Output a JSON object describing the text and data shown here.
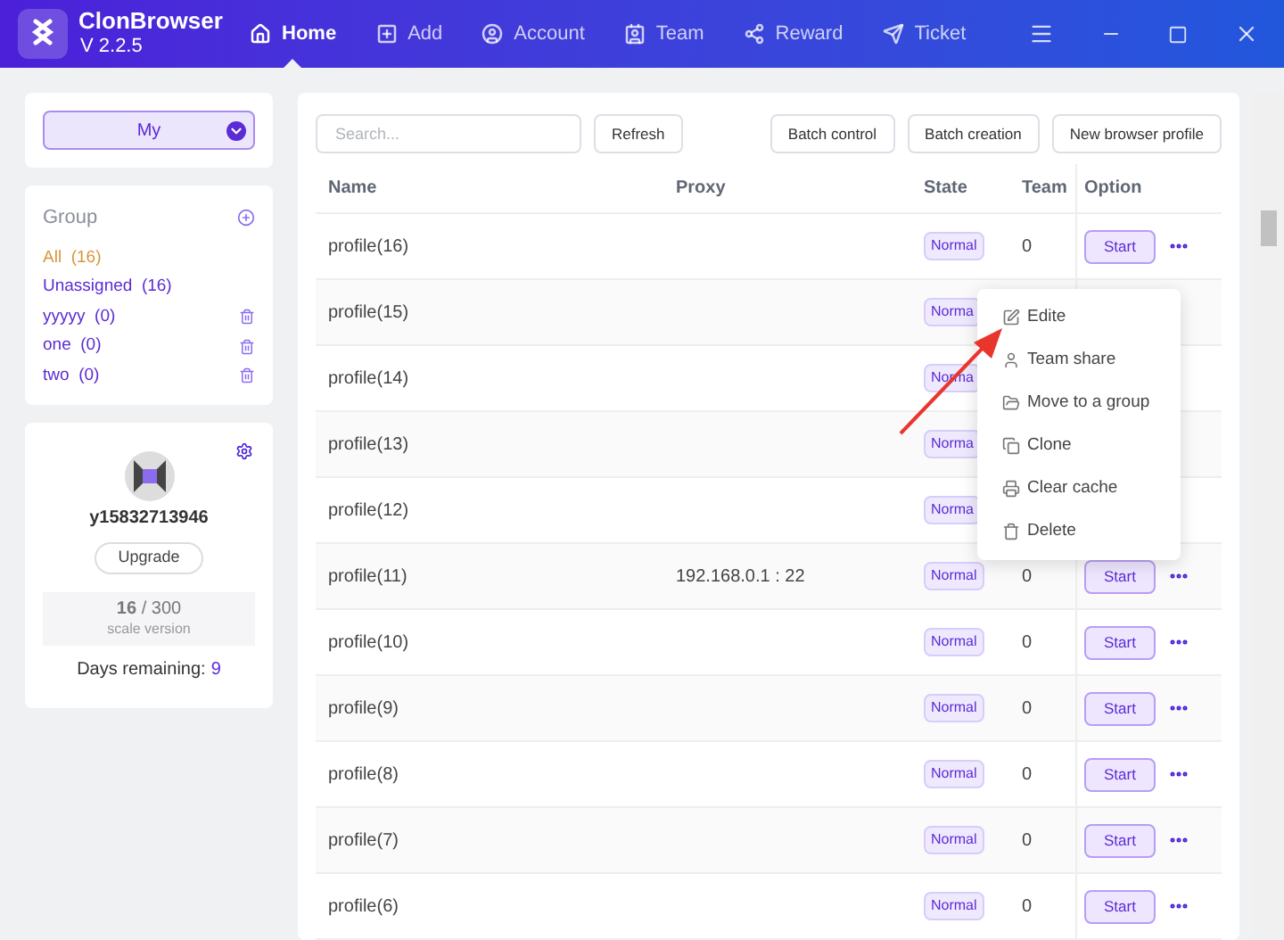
{
  "app": {
    "name": "ClonBrowser",
    "version": "V 2.2.5"
  },
  "nav": [
    {
      "label": "Home",
      "selected": true
    },
    {
      "label": "Add",
      "selected": false
    },
    {
      "label": "Account",
      "selected": false
    },
    {
      "label": "Team",
      "selected": false
    },
    {
      "label": "Reward",
      "selected": false
    },
    {
      "label": "Ticket",
      "selected": false
    }
  ],
  "group_selector": {
    "label": "My"
  },
  "groups": {
    "title": "Group",
    "items": [
      {
        "label": "All",
        "count": "(16)",
        "selected": true,
        "deletable": false
      },
      {
        "label": "Unassigned",
        "count": "(16)",
        "selected": false,
        "deletable": false
      },
      {
        "label": "yyyyy",
        "count": "(0)",
        "selected": false,
        "deletable": true
      },
      {
        "label": "one",
        "count": "(0)",
        "selected": false,
        "deletable": true
      },
      {
        "label": "two",
        "count": "(0)",
        "selected": false,
        "deletable": true
      }
    ]
  },
  "account": {
    "username": "y15832713946",
    "upgrade": "Upgrade",
    "usage": "**16** / 300",
    "plan": "scale version",
    "days_label": "Days remaining:",
    "days": "9"
  },
  "toolbar": {
    "search_placeholder": "Search...",
    "buttons": [
      "Refresh",
      "Batch control",
      "Batch creation",
      "New browser profile"
    ]
  },
  "table": {
    "columns": [
      "Name",
      "Proxy",
      "State",
      "Team",
      "Option"
    ],
    "rows": [
      {
        "name": "profile(16)",
        "state": "Normal",
        "team": "0",
        "action": "Start"
      },
      {
        "name": "profile(15)",
        "state": "Norma"
      },
      {
        "name": "profile(14)",
        "state": "Norma"
      },
      {
        "name": "profile(13)",
        "state": "Norma"
      },
      {
        "name": "profile(12)",
        "state": "Norma"
      },
      {
        "name": "profile(11)",
        "proxy": "192.168.0.1 : 22",
        "state": "Normal",
        "team": "0",
        "action": "Start"
      },
      {
        "name": "profile(10)",
        "state": "Normal",
        "team": "0",
        "action": "Start"
      },
      {
        "name": "profile(9)",
        "state": "Normal",
        "team": "0",
        "action": "Start"
      },
      {
        "name": "profile(8)",
        "state": "Normal",
        "team": "0",
        "action": "Start"
      },
      {
        "name": "profile(7)",
        "state": "Normal",
        "team": "0",
        "action": "Start"
      },
      {
        "name": "profile(6)",
        "state": "Normal",
        "team": "0",
        "action": "Start"
      }
    ]
  },
  "context_menu": [
    "Edite",
    "Team share",
    "Move to a group",
    "Clone",
    "Clear cache",
    "Delete"
  ]
}
